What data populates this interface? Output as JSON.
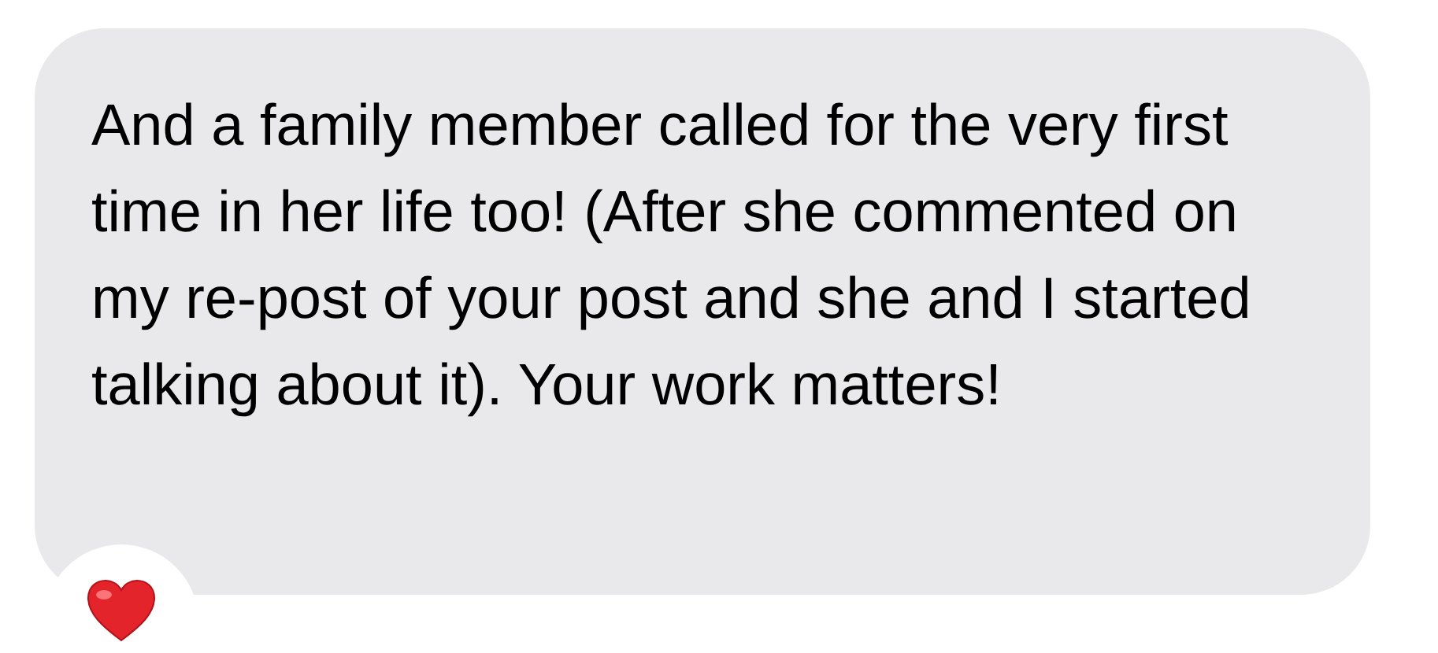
{
  "message": {
    "text": "And a family member called for the very first time in her life too! (After she commented on my re-post of your post and she and I started talking about it). Your work matters!"
  },
  "reaction": {
    "kind": "heart"
  }
}
